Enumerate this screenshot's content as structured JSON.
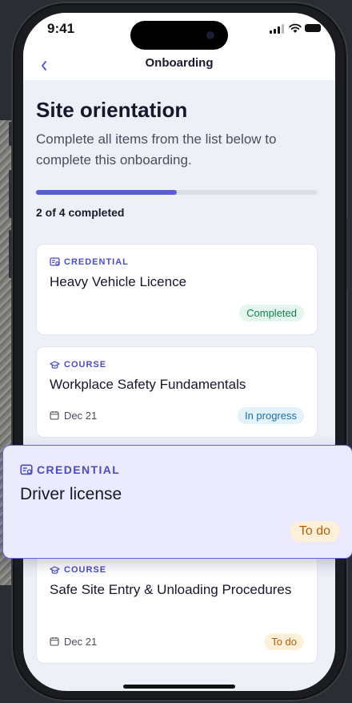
{
  "status_bar": {
    "time": "9:41"
  },
  "nav": {
    "title": "Onboarding",
    "back_icon": "chevron-left-icon"
  },
  "page": {
    "title": "Site orientation",
    "subtitle": "Complete all items from the list below to complete this onboarding.",
    "progress": {
      "completed": 2,
      "total": 4,
      "fraction": 0.5,
      "label": "2 of 4 completed"
    }
  },
  "colors": {
    "accent": "#5b5bd6",
    "completed": "#16804d",
    "in_progress": "#1b6fa8",
    "todo": "#b25e09"
  },
  "items": [
    {
      "type": "CREDENTIAL",
      "icon": "credential-icon",
      "title": "Heavy Vehicle Licence",
      "date": "",
      "status": "Completed"
    },
    {
      "type": "COURSE",
      "icon": "graduation-cap-icon",
      "title": "Workplace Safety Fundamentals",
      "date": "Dec 21",
      "status": "In progress"
    },
    {
      "type": "COURSE",
      "icon": "graduation-cap-icon",
      "title": "Safe Site Entry & Unloading Procedures",
      "date": "Dec 21",
      "status": "To do"
    }
  ],
  "dragging_item": {
    "type": "CREDENTIAL",
    "icon": "credential-icon",
    "title": "Driver license",
    "status": "To do"
  }
}
